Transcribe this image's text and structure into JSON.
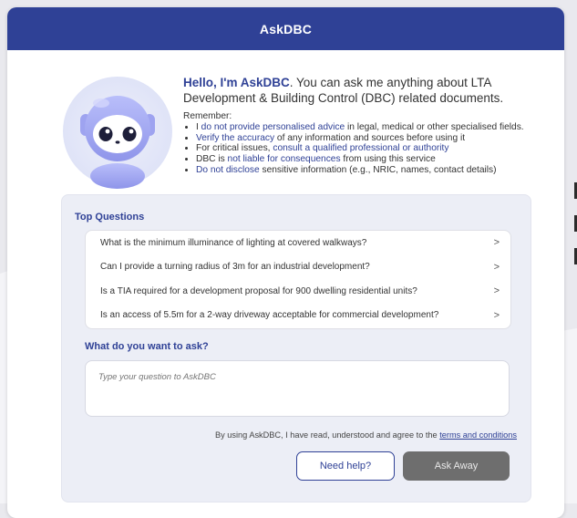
{
  "header": {
    "title": "AskDBC"
  },
  "intro": {
    "hello": "Hello, I'm AskDBC",
    "rest": ". You can ask me anything about LTA Development & Building Control (DBC) related documents."
  },
  "remember": {
    "heading": "Remember:",
    "items": [
      {
        "pre": "I ",
        "hl": "do not provide personalised advice",
        "post": " in legal, medical or other specialised fields."
      },
      {
        "pre": "",
        "hl": "Verify the accuracy",
        "post": " of any information and sources before using it"
      },
      {
        "pre": "For critical issues, ",
        "hl": "consult a qualified professional or authority",
        "post": ""
      },
      {
        "pre": "DBC is ",
        "hl": "not liable for consequences",
        "post": " from using this service"
      },
      {
        "pre": "",
        "hl": "Do not disclose",
        "post": " sensitive information (e.g., NRIC, names, contact details)"
      }
    ]
  },
  "top_questions": {
    "title": "Top Questions",
    "items": [
      "What is the minimum illuminance of lighting at covered walkways?",
      "Can I provide a turning radius of 3m for an industrial development?",
      "Is a TIA required for a development proposal for 900 dwelling residential units?",
      "Is an access of 5.5m for a 2-way driveway acceptable for commercial development?"
    ]
  },
  "ask": {
    "label": "What do you want to ask?",
    "placeholder": "Type your question to AskDBC",
    "value": ""
  },
  "terms": {
    "text": "By using AskDBC, I have read, understood and agree to the ",
    "link": "terms and conditions"
  },
  "buttons": {
    "help": "Need help?",
    "ask": "Ask Away"
  },
  "colors": {
    "brand": "#2f4196",
    "panel": "#eceef6",
    "ask_button": "#6e6e6e"
  }
}
